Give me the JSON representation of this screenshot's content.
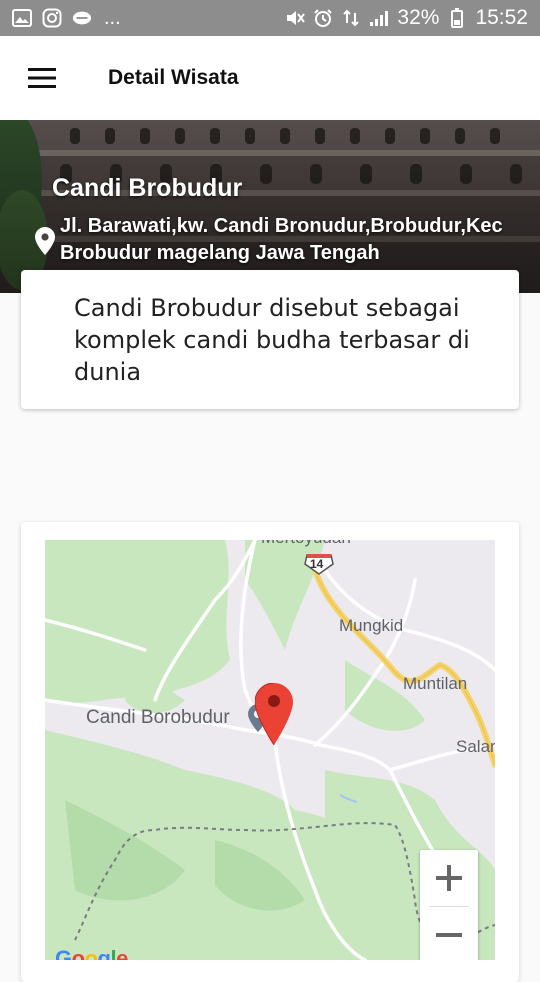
{
  "status_bar": {
    "battery": "32%",
    "time": "15:52",
    "overflow": "..."
  },
  "header": {
    "title": "Detail Wisata",
    "menu_icon": "hamburger-menu-icon"
  },
  "hero": {
    "title": "Candi Brobudur",
    "address": "Jl. Barawati,kw. Candi Bronudur,Brobudur,Kec Brobudur magelang Jawa Tengah",
    "pin_icon": "location-pin-icon"
  },
  "description": {
    "text": "Candi Brobudur disebut sebagai komplek candi budha terbasar di dunia"
  },
  "map": {
    "labels": {
      "top": "Mertoyudan",
      "road_shield": "14",
      "town1": "Mungkid",
      "town2": "Muntilan",
      "town3": "Salar",
      "poi": "Candi Borobudur"
    },
    "zoom_in": "+",
    "zoom_out": "−",
    "logo": "Google",
    "colors": {
      "marker": "#ea4335",
      "road_major": "#f5d36b",
      "green_area": "#c9e7bf",
      "land": "#ece9ef"
    }
  }
}
